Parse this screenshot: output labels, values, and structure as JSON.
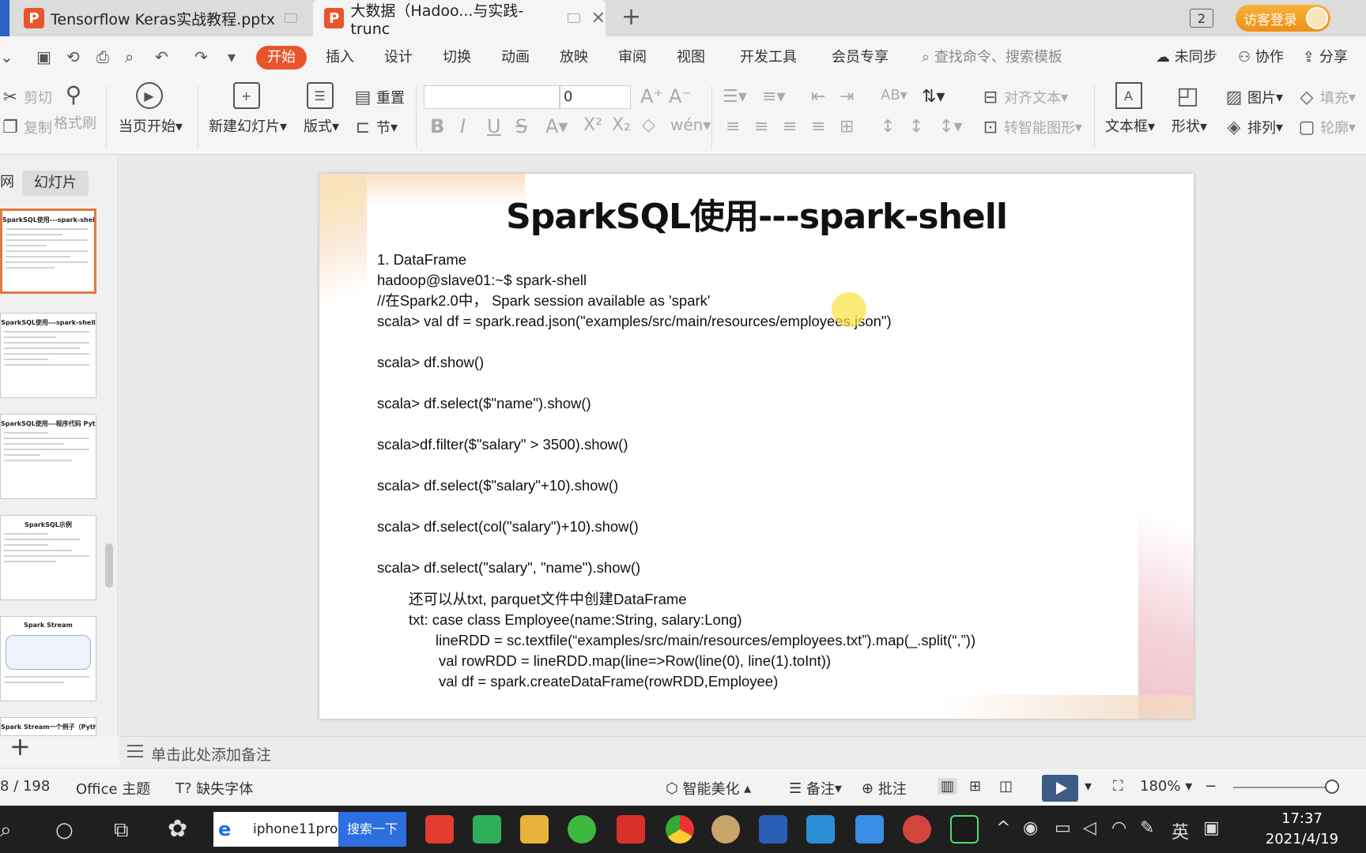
{
  "tabs": [
    {
      "label": "Tensorflow Keras实战教程.pptx",
      "icon": "P"
    },
    {
      "label": "大数据（Hadoo...与实践-trunc",
      "icon": "P",
      "active": true
    }
  ],
  "tabbar": {
    "add": "+",
    "window_count": "2",
    "guest_login": "访客登录"
  },
  "menu": {
    "items": [
      "开始",
      "插入",
      "设计",
      "切换",
      "动画",
      "放映",
      "审阅",
      "视图",
      "开发工具",
      "会员专享"
    ],
    "active": "开始",
    "search_placeholder": "查找命令、搜索模板",
    "unsynced": "未同步",
    "collaborate": "协作",
    "share": "分享"
  },
  "ribbon": {
    "cut": "剪切",
    "copy": "复制",
    "format_painter": "格式刷",
    "play_from_current": "当页开始",
    "new_slide": "新建幻灯片",
    "layout": "版式",
    "reset": "重置",
    "section": "节",
    "font_name": "",
    "font_size": "0",
    "align_text": "对齐文本",
    "to_smartart": "转智能图形",
    "text_box": "文本框",
    "shape": "形状",
    "picture": "图片",
    "fill": "填充",
    "arrange": "排列",
    "outline": "轮廓"
  },
  "left_panel": {
    "tab_outline": "网",
    "tab_slides": "幻灯片",
    "thumbnails": [
      "SparkSQL使用---spark-shell",
      "SparkSQL使用---spark-shell",
      "SparkSQL使用---程序代码 Python",
      "SparkSQL示例",
      "Spark Stream",
      "Spark Stream一个例子（Python）"
    ],
    "add": "+"
  },
  "slide": {
    "title": "SparkSQL使用---spark-shell",
    "lines": [
      "1. DataFrame",
      "hadoop@slave01:~$ spark-shell",
      "//在Spark2.0中，  Spark session available as 'spark'",
      "scala> val df = spark.read.json(\"examples/src/main/resources/employees.json\")",
      "",
      "scala> df.show()",
      "",
      "scala> df.select($\"name\").show()",
      "",
      "scala>df.filter($\"salary\" > 3500).show()",
      "",
      "scala> df.select($\"salary\"+10).show()",
      "",
      "scala> df.select(col(\"salary\")+10).show()",
      "",
      "scala> df.select(\"salary\", \"name\").show()"
    ],
    "notes": [
      {
        "text": "还可以从txt, parquet文件中创建DataFrame",
        "indent": 40
      },
      {
        "text": "txt: case class Employee(name:String, salary:Long)",
        "indent": 40
      },
      {
        "text": "lineRDD = sc.textfile(“examples/src/main/resources/employees.txt”).map(_.split(“,”))",
        "indent": 74
      },
      {
        "text": "val rowRDD = lineRDD.map(line=>Row(line(0), line(1).toInt))",
        "indent": 78
      },
      {
        "text": "val df = spark.createDataFrame(rowRDD,Employee)",
        "indent": 78
      }
    ]
  },
  "notes_placeholder": "单击此处添加备注",
  "status": {
    "page": "8 / 198",
    "theme": "Office 主题",
    "missing_fonts": "缺失字体",
    "smart_beautify": "智能美化",
    "notes": "备注",
    "comments": "批注",
    "zoom": "180%",
    "zoom_level_percent": 180
  },
  "taskbar": {
    "search_query": "iphone11pro",
    "search_button": "搜索一下",
    "ime": "英",
    "time": "17:37",
    "date": "2021/4/19"
  },
  "colors": {
    "accent": "#e8552d",
    "guest": "#f0961a",
    "play": "#3c5c86",
    "taskbar": "#1f1f1f"
  }
}
